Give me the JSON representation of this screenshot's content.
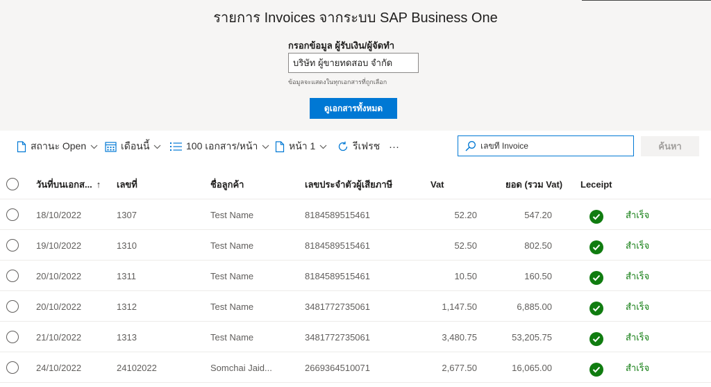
{
  "header": {
    "title": "รายการ Invoices จากระบบ SAP Business One",
    "field_label": "กรอกข้อมูล ผู้รับเงิน/ผู้จัดทำ",
    "field_value": "บริษัท ผู้ขายทดสอบ จำกัด",
    "field_hint": "ข้อมูลจะแสดงในทุกเอกสารที่ถูกเลือก",
    "view_all_label": "ดูเอกสารทั้งหมด"
  },
  "toolbar": {
    "status_label": "สถานะ Open",
    "month_label": "เดือนนี้",
    "per_page_label": "100 เอกสาร/หน้า",
    "page_label": "หน้า 1",
    "refresh_label": "รีเฟรช",
    "more_label": "···",
    "search_placeholder": "เลขที่ Invoice",
    "search_button_label": "ค้นหา"
  },
  "table": {
    "columns": {
      "date": "วันที่บนเอกส...",
      "sort_indicator": "↑",
      "number": "เลขที่",
      "customer": "ชื่อลูกค้า",
      "tax_id": "เลขประจำตัวผู้เสียภาษี",
      "vat": "Vat",
      "total": "ยอด (รวม Vat)",
      "receipt": "Leceipt"
    },
    "rows": [
      {
        "date": "18/10/2022",
        "number": "1307",
        "customer": "Test Name",
        "tax_id": "8184589515461",
        "vat": "52.20",
        "total": "547.20",
        "status": "สำเร็จ"
      },
      {
        "date": "19/10/2022",
        "number": "1310",
        "customer": "Test Name",
        "tax_id": "8184589515461",
        "vat": "52.50",
        "total": "802.50",
        "status": "สำเร็จ"
      },
      {
        "date": "20/10/2022",
        "number": "1311",
        "customer": "Test Name",
        "tax_id": "8184589515461",
        "vat": "10.50",
        "total": "160.50",
        "status": "สำเร็จ"
      },
      {
        "date": "20/10/2022",
        "number": "1312",
        "customer": "Test Name",
        "tax_id": "3481772735061",
        "vat": "1,147.50",
        "total": "6,885.00",
        "status": "สำเร็จ"
      },
      {
        "date": "21/10/2022",
        "number": "1313",
        "customer": "Test Name",
        "tax_id": "3481772735061",
        "vat": "3,480.75",
        "total": "53,205.75",
        "status": "สำเร็จ"
      },
      {
        "date": "24/10/2022",
        "number": "24102022",
        "customer": "Somchai Jaid...",
        "tax_id": "2669364510071",
        "vat": "2,677.50",
        "total": "16,065.00",
        "status": "สำเร็จ"
      }
    ]
  },
  "colors": {
    "primary": "#0078d4",
    "success": "#107c10",
    "header_bg": "#f6f5f4"
  }
}
